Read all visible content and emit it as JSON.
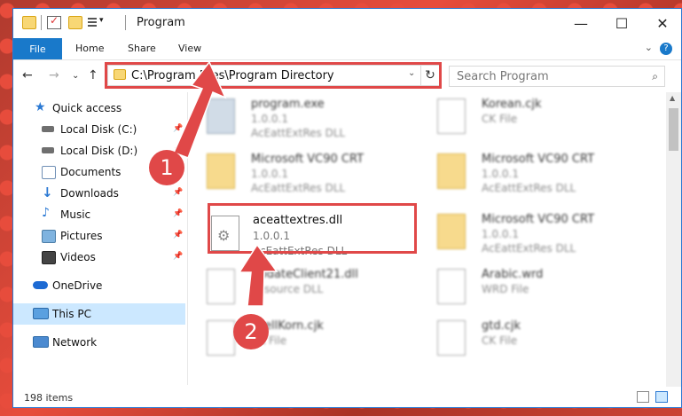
{
  "window": {
    "title": "Program"
  },
  "ribbon": {
    "file": "File",
    "tabs": [
      "Home",
      "Share",
      "View"
    ],
    "help": "?"
  },
  "address": {
    "path": "C:\\Program Files\\Program Directory"
  },
  "search": {
    "placeholder": "Search Program"
  },
  "sidebar": {
    "items": [
      {
        "label": "Quick access",
        "icon": "star-icon"
      },
      {
        "label": "Local Disk (C:)",
        "icon": "drive-icon"
      },
      {
        "label": "Local Disk (D:)",
        "icon": "drive-icon"
      },
      {
        "label": "Documents",
        "icon": "documents-icon"
      },
      {
        "label": "Downloads",
        "icon": "download-icon"
      },
      {
        "label": "Music",
        "icon": "music-icon"
      },
      {
        "label": "Pictures",
        "icon": "pictures-icon"
      },
      {
        "label": "Videos",
        "icon": "videos-icon"
      },
      {
        "label": "OneDrive",
        "icon": "cloud-icon"
      },
      {
        "label": "This PC",
        "icon": "computer-icon"
      },
      {
        "label": "Network",
        "icon": "network-icon"
      }
    ]
  },
  "files": [
    {
      "name": "program.exe",
      "line1": "1.0.0.1",
      "line2": "AcEattExtRes DLL"
    },
    {
      "name": "Korean.cjk",
      "line1": "CK File",
      "line2": ""
    },
    {
      "name": "Microsoft VC90 CRT",
      "line1": "1.0.0.1",
      "line2": "AcEattExtRes DLL"
    },
    {
      "name": "Microsoft VC90 CRT",
      "line1": "1.0.0.1",
      "line2": "AcEattExtRes DLL"
    },
    {
      "name": "aceattextres.dll",
      "line1": "1.0.0.1",
      "line2": "AcEattExtRes DLL"
    },
    {
      "name": "Microsoft VC90 CRT",
      "line1": "1.0.0.1",
      "line2": "AcEattExtRes DLL"
    },
    {
      "name": "UpdateClient21.dll",
      "line1": "Resource DLL",
      "line2": ""
    },
    {
      "name": "Arabic.wrd",
      "line1": "WRD File",
      "line2": ""
    },
    {
      "name": "shellKorn.cjk",
      "line1": "CK File",
      "line2": ""
    },
    {
      "name": "gtd.cjk",
      "line1": "CK File",
      "line2": ""
    }
  ],
  "status": {
    "items": "198 items"
  },
  "badges": [
    "1",
    "2"
  ],
  "colors": {
    "accent": "#1979ca",
    "highlight": "#e04848"
  }
}
